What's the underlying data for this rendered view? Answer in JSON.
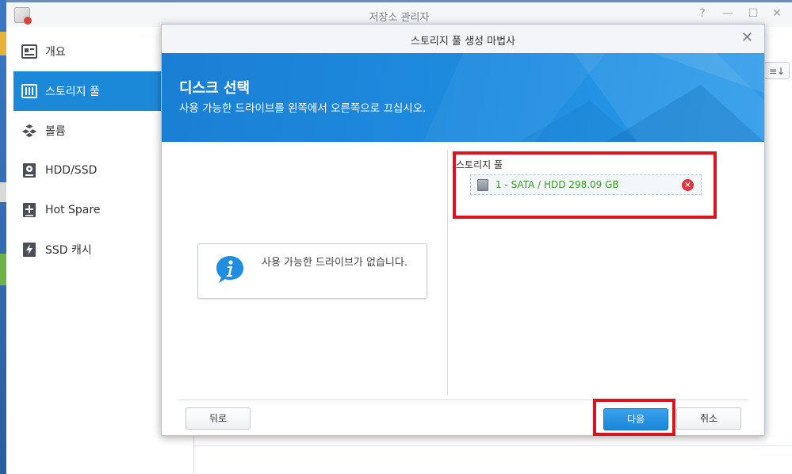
{
  "window": {
    "title": "저장소 관리자",
    "controls": [
      "?",
      "—",
      "☐",
      "✕"
    ]
  },
  "sidebar": {
    "items": [
      {
        "label": "개요",
        "icon": "overview-icon"
      },
      {
        "label": "스토리지 풀",
        "icon": "storage-pool-icon",
        "active": true
      },
      {
        "label": "볼륨",
        "icon": "volume-icon"
      },
      {
        "label": "HDD/SSD",
        "icon": "hdd-icon"
      },
      {
        "label": "Hot Spare",
        "icon": "hot-spare-icon"
      },
      {
        "label": "SSD 캐시",
        "icon": "ssd-cache-icon"
      }
    ]
  },
  "toolbar": {
    "sort_icon": "≡↓"
  },
  "dialog": {
    "title": "스토리지 풀 생성 마법사",
    "close": "✕",
    "banner": {
      "heading": "디스크 선택",
      "subtitle": "사용 가능한 드라이브를 왼쪽에서 오른쪽으로 끄십시오."
    },
    "left": {
      "info_text": "사용 가능한 드라이브가 없습니다."
    },
    "right": {
      "pool_label": "스토리지 풀",
      "drive": "1 - SATA / HDD 298.09 GB"
    },
    "buttons": {
      "back": "뒤로",
      "next": "다음",
      "cancel": "취소"
    }
  },
  "colors": {
    "accent": "#1c89d8",
    "highlight": "#d9141f",
    "drive_text": "#3b9b27"
  }
}
